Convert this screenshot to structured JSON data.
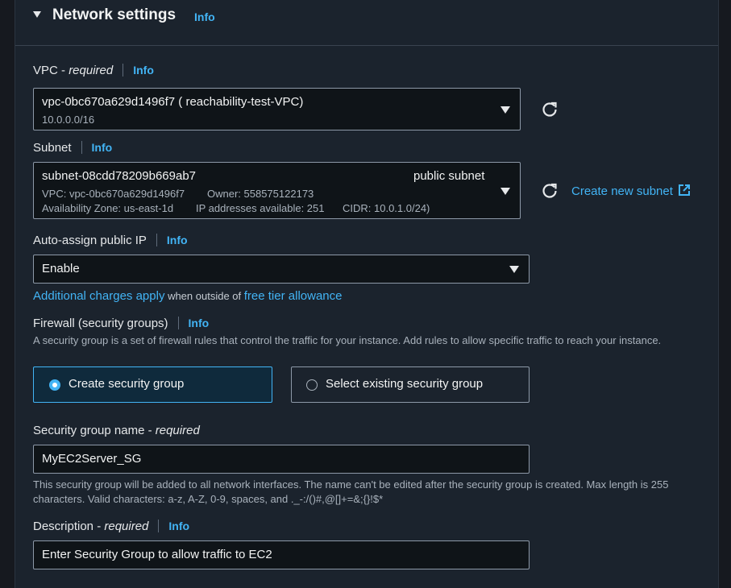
{
  "section": {
    "title": "Network settings",
    "info": "Info"
  },
  "vpc": {
    "label": "VPC - ",
    "label_em": "required",
    "info": "Info",
    "value": "vpc-0bc670a629d1496f7 ( reachability-test-VPC)",
    "cidr": "10.0.0.0/16"
  },
  "subnet": {
    "label": "Subnet",
    "info": "Info",
    "value": "subnet-08cdd78209b669ab7",
    "tag": "public subnet",
    "vpc_line": "VPC: vpc-0bc670a629d1496f7",
    "owner_line": "Owner: 558575122173",
    "az_line": "Availability Zone: us-east-1d",
    "ip_line": "IP addresses available: 251",
    "cidr_line": "CIDR: 10.0.1.0/24)",
    "create_link": "Create new subnet"
  },
  "auto_ip": {
    "label": "Auto-assign public IP",
    "info": "Info",
    "value": "Enable",
    "charges_link": "Additional charges apply",
    "charges_mid": " when outside of ",
    "free_tier_link": "free tier allowance"
  },
  "firewall": {
    "label": "Firewall (security groups)",
    "info": "Info",
    "description": "A security group is a set of firewall rules that control the traffic for your instance. Add rules to allow specific traffic to reach your instance.",
    "option_create": "Create security group",
    "option_select": "Select existing security group",
    "selected": "create"
  },
  "sg_name": {
    "label": "Security group name - ",
    "label_em": "required",
    "value": "MyEC2Server_SG",
    "help": "This security group will be added to all network interfaces. The name can't be edited after the security group is created. Max length is 255 characters. Valid characters: a-z, A-Z, 0-9, spaces, and ._-:/()#,@[]+=&;{}!$*"
  },
  "description": {
    "label": "Description - ",
    "label_em": "required",
    "info": "Info",
    "value": "Enter Security Group to allow traffic to EC2"
  },
  "icons": [
    "caret-down-icon",
    "dropdown-arrow-icon",
    "refresh-icon",
    "external-link-icon",
    "radio-button-icon"
  ],
  "colors": {
    "accent": "#42b4f5",
    "selected_card_bg": "#0f2a3c",
    "background": "#1b232d"
  }
}
